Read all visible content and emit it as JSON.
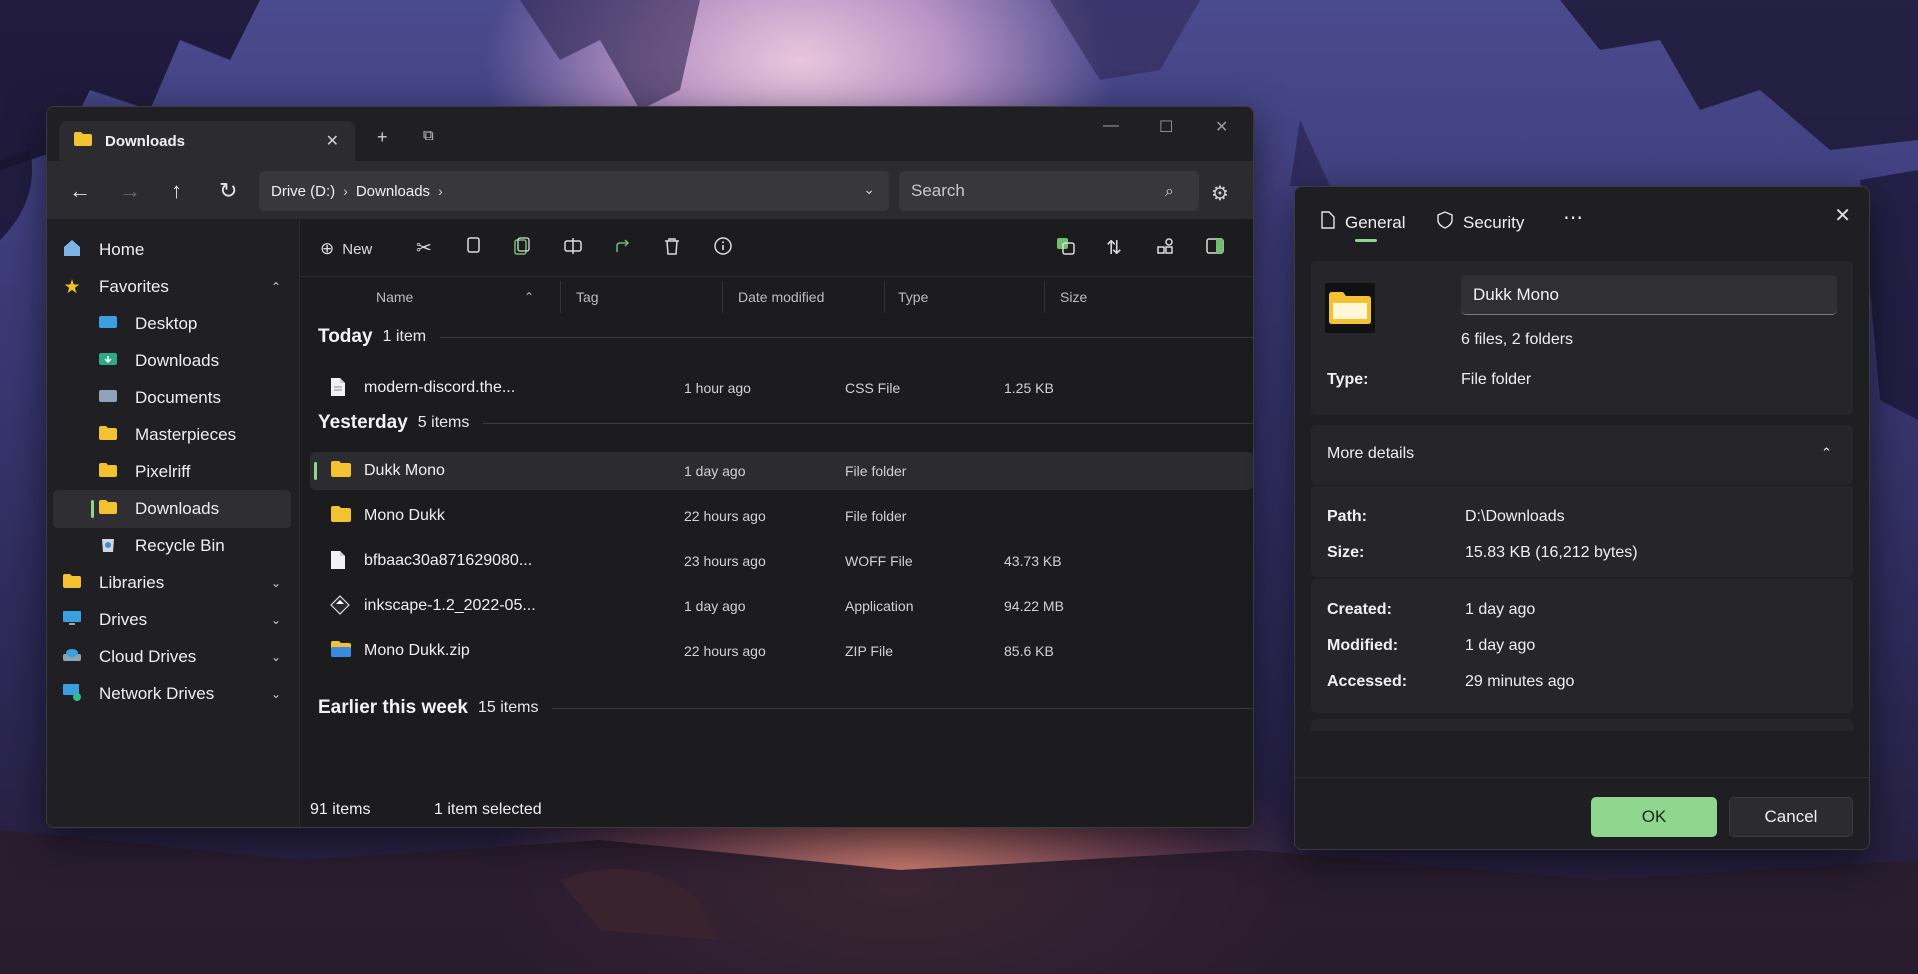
{
  "explorer": {
    "tab": {
      "title": "Downloads",
      "close": "✕"
    },
    "titlebar": {
      "new_tab": "+",
      "duplicate": "⧉",
      "minimize": "—",
      "maximize": "☐",
      "close": "✕"
    },
    "nav": {
      "back": "←",
      "forward": "→",
      "up": "↑",
      "refresh": "↻"
    },
    "address": {
      "segments": [
        "Drive (D:)",
        "Downloads"
      ],
      "separator": "›",
      "dropdown": "⌄"
    },
    "search": {
      "placeholder": "Search",
      "icon": "⌕"
    },
    "settings_icon": "⚙",
    "sidebar": {
      "home": "Home",
      "favorites": "Favorites",
      "items": [
        "Desktop",
        "Downloads",
        "Documents",
        "Masterpieces",
        "Pixelriff",
        "Downloads",
        "Recycle Bin"
      ],
      "libraries": "Libraries",
      "drives": "Drives",
      "cloud": "Cloud Drives",
      "network": "Network Drives",
      "selected_item": "Downloads"
    },
    "toolbar": {
      "new_label": "New",
      "more": "⋯"
    },
    "columns": {
      "name": "Name",
      "tag": "Tag",
      "date": "Date modified",
      "type": "Type",
      "size": "Size"
    },
    "groups": [
      {
        "title": "Today",
        "count": "1 item"
      },
      {
        "title": "Yesterday",
        "count": "5 items"
      },
      {
        "title": "Earlier this week",
        "count": "15 items"
      }
    ],
    "rows": [
      {
        "name": "modern-discord.the...",
        "date": "1 hour ago",
        "type": "CSS File",
        "size": "1.25 KB",
        "icon": "file-icon"
      },
      {
        "name": "Dukk Mono",
        "date": "1 day ago",
        "type": "File folder",
        "size": "",
        "icon": "folder-icon",
        "selected": true
      },
      {
        "name": "Mono Dukk",
        "date": "22 hours ago",
        "type": "File folder",
        "size": "",
        "icon": "folder-icon"
      },
      {
        "name": "bfbaac30a871629080...",
        "date": "23 hours ago",
        "type": "WOFF File",
        "size": "43.73 KB",
        "icon": "file-icon"
      },
      {
        "name": "inkscape-1.2_2022-05...",
        "date": "1 day ago",
        "type": "Application",
        "size": "94.22 MB",
        "icon": "app-icon"
      },
      {
        "name": "Mono Dukk.zip",
        "date": "22 hours ago",
        "type": "ZIP File",
        "size": "85.6 KB",
        "icon": "zip-folder-icon"
      }
    ],
    "status": {
      "count": "91 items",
      "selected": "1 item selected"
    }
  },
  "properties": {
    "tabs": {
      "general": "General",
      "security": "Security",
      "more": "⋯"
    },
    "close": "✕",
    "name_value": "Dukk Mono",
    "summary": "6 files, 2 folders",
    "type_label": "Type:",
    "type_value": "File folder",
    "more_details": "More details",
    "collapse": "⌃",
    "path_label": "Path:",
    "path_value": "D:\\Downloads",
    "size_label": "Size:",
    "size_value": "15.83 KB (16,212 bytes)",
    "created_label": "Created:",
    "created_value": "1 day ago",
    "modified_label": "Modified:",
    "modified_value": "1 day ago",
    "accessed_label": "Accessed:",
    "accessed_value": "29 minutes ago",
    "ok": "OK",
    "cancel": "Cancel"
  },
  "colors": {
    "accent": "#8fd68f",
    "window_bg": "#1f1f23",
    "folder": "#f2c230"
  }
}
